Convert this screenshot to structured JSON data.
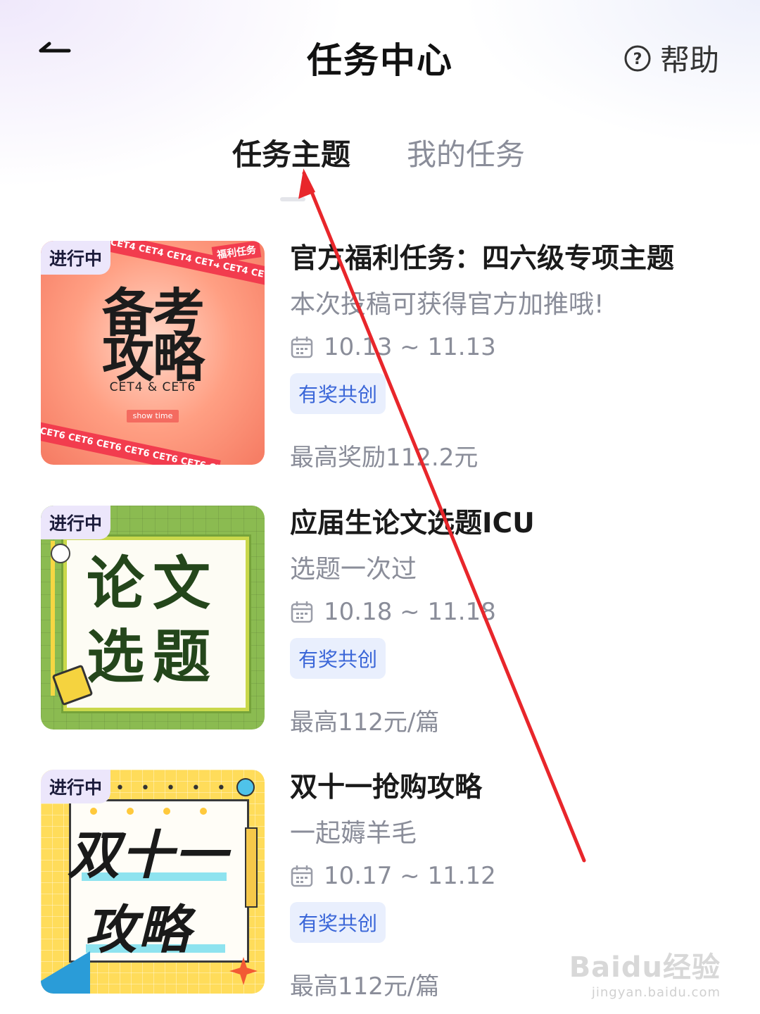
{
  "header": {
    "title": "任务中心",
    "help_label": "帮助"
  },
  "tabs": [
    {
      "label": "任务主题",
      "active": true
    },
    {
      "label": "我的任务",
      "active": false
    }
  ],
  "tasks": [
    {
      "status": "进行中",
      "title": "官方福利任务：四六级专项主题",
      "subtitle": "本次投稿可获得官方加推哦!",
      "date": "10.13 ~ 11.13",
      "tag": "有奖共创",
      "reward": "最高奖励112.2元",
      "thumb": {
        "line1": "备考",
        "line2": "攻略",
        "caption": "CET4 & CET6",
        "pill": "show time",
        "corner": "福利任务",
        "stripe_top": "CET4 CET4 CET4 CET4 CET4 CET4 CET4",
        "stripe_bottom": "CET6 CET6 CET6 CET6 CET6 CET6 CET6"
      }
    },
    {
      "status": "进行中",
      "title": "应届生论文选题ICU",
      "subtitle": "选题一次过",
      "date": "10.18 ~ 11.18",
      "tag": "有奖共创",
      "reward": "最高112元/篇",
      "thumb": {
        "line1": "论文",
        "line2": "选题"
      }
    },
    {
      "status": "进行中",
      "title": "双十一抢购攻略",
      "subtitle": "一起薅羊毛",
      "date": "10.17 ~ 11.12",
      "tag": "有奖共创",
      "reward": "最高112元/篇",
      "thumb": {
        "line1": "双十一",
        "line2": "攻略",
        "dots": "• • • • • • • • •"
      }
    }
  ],
  "watermark": {
    "logo": "Baidu经验",
    "url": "jingyan.baidu.com"
  },
  "colors": {
    "accent_blue": "#3a66d8",
    "tag_bg": "#e9effd",
    "status_bg": "#ece6fb",
    "annotation_red": "#e8262b"
  }
}
